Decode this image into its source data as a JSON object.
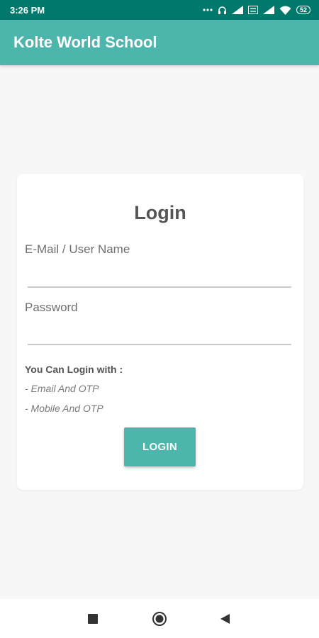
{
  "status_bar": {
    "time": "3:26 PM",
    "battery": "52",
    "icons": [
      "more-dots-icon",
      "headset-icon",
      "signal-icon",
      "volte-icon",
      "signal-icon",
      "wifi-icon",
      "battery-icon"
    ]
  },
  "app_bar": {
    "title": "Kolte World School"
  },
  "login_card": {
    "title": "Login",
    "username_label": "E-Mail / User Name",
    "username_value": "",
    "password_label": "Password",
    "password_value": "",
    "hint_title": "You Can Login with :",
    "hint_items": [
      "- Email And OTP",
      "- Mobile And OTP"
    ],
    "login_button": "LOGIN"
  },
  "nav_bar": {
    "icons": [
      "recents-square-icon",
      "home-circle-icon",
      "back-triangle-icon"
    ]
  },
  "colors": {
    "status_bar": "#00786b",
    "primary": "#4db6ac",
    "background": "#f7f7f7",
    "card": "#ffffff"
  }
}
